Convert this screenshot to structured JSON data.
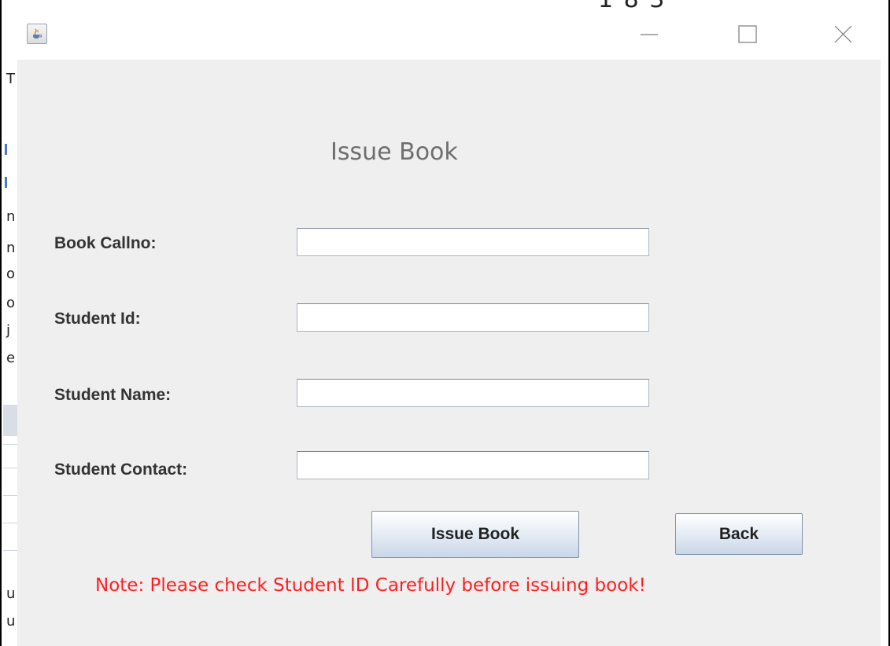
{
  "window": {
    "title": "",
    "controls": {
      "minimize_icon": "minimize-icon",
      "maximize_icon": "maximize-icon",
      "close_icon": "close-icon"
    },
    "app_icon": "java-cup-icon"
  },
  "form": {
    "heading": "Issue Book",
    "fields": [
      {
        "label": "Book Callno:",
        "value": "",
        "placeholder": ""
      },
      {
        "label": "Student Id:",
        "value": "",
        "placeholder": ""
      },
      {
        "label": "Student Name:",
        "value": "",
        "placeholder": ""
      },
      {
        "label": "Student Contact:",
        "value": "",
        "placeholder": ""
      }
    ],
    "buttons": {
      "issue_label": "Issue Book",
      "back_label": "Back"
    },
    "note": "Note: Please check Student ID Carefully before issuing book!"
  },
  "colors": {
    "note_text": "#ff1f1f",
    "window_bg": "#efefef",
    "heading_text": "#6e6e6e",
    "button_border": "#7f93ad"
  }
}
